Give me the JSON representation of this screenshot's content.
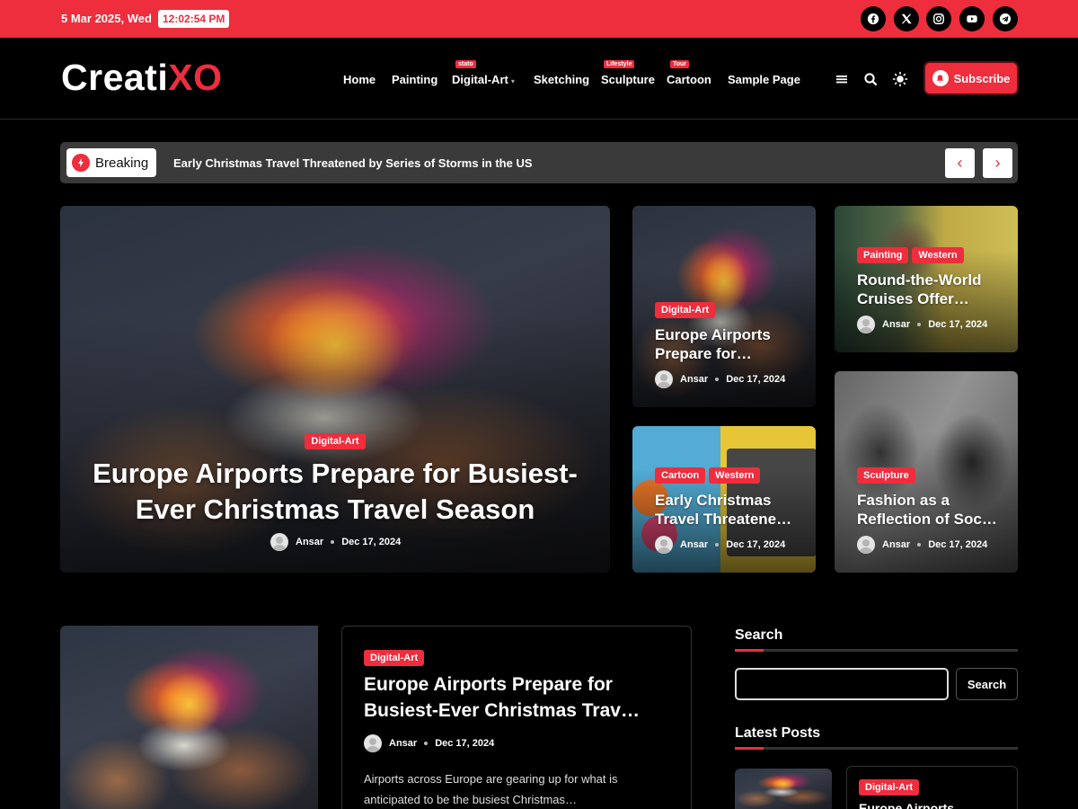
{
  "topbar": {
    "date": "5 Mar 2025, Wed",
    "time": "12:02:54 PM",
    "social": [
      "facebook-icon",
      "x-icon",
      "instagram-icon",
      "youtube-icon",
      "telegram-icon"
    ]
  },
  "header": {
    "logo_main": "Creati",
    "logo_accent": "XO",
    "nav": [
      {
        "label": "Home",
        "tag": ""
      },
      {
        "label": "Painting",
        "tag": ""
      },
      {
        "label": "Digital-Art",
        "tag": "stato"
      },
      {
        "label": "Sketching",
        "tag": ""
      },
      {
        "label": "Sculpture",
        "tag": "Lifestyle"
      },
      {
        "label": "Cartoon",
        "tag": "Tour"
      },
      {
        "label": "Sample Page",
        "tag": ""
      }
    ],
    "subscribe": "Subscribe"
  },
  "breaking": {
    "label": "Breaking",
    "headline": "Early Christmas Travel Threatened by Series of Storms in the US",
    "prev": "‹",
    "next": "›"
  },
  "hero": {
    "category": "Digital-Art",
    "title": "Europe Airports Prepare for Busiest-Ever Christmas Travel Season",
    "author": "Ansar",
    "date": "Dec 17, 2024"
  },
  "grid": [
    {
      "categories": [
        "Digital-Art"
      ],
      "title": "Europe Airports Prepare for…",
      "author": "Ansar",
      "date": "Dec 17, 2024"
    },
    {
      "categories": [
        "Painting",
        "Western"
      ],
      "title": "Round-the-World Cruises Offer…",
      "author": "Ansar",
      "date": "Dec 17, 2024"
    },
    {
      "categories": [
        "Cartoon",
        "Western"
      ],
      "title": "Early Christmas Travel Threatene…",
      "author": "Ansar",
      "date": "Dec 17, 2024"
    },
    {
      "categories": [
        "Sculpture"
      ],
      "title": "Fashion as a Reflection of Soc…",
      "author": "Ansar",
      "date": "Dec 17, 2024"
    }
  ],
  "post": {
    "category": "Digital-Art",
    "title": "Europe Airports Prepare for Busiest-Ever Christmas Trav…",
    "author": "Ansar",
    "date": "Dec 17, 2024",
    "excerpt": "Airports across Europe are gearing up for what is anticipated to be the busiest Christmas…"
  },
  "sidebar": {
    "search_title": "Search",
    "search_button": "Search",
    "search_value": "",
    "latest_title": "Latest Posts",
    "latest_category": "Digital-Art",
    "latest_title_preview": "Europe Airports"
  },
  "colors": {
    "accent": "#ee2d3d",
    "background": "#000000"
  }
}
